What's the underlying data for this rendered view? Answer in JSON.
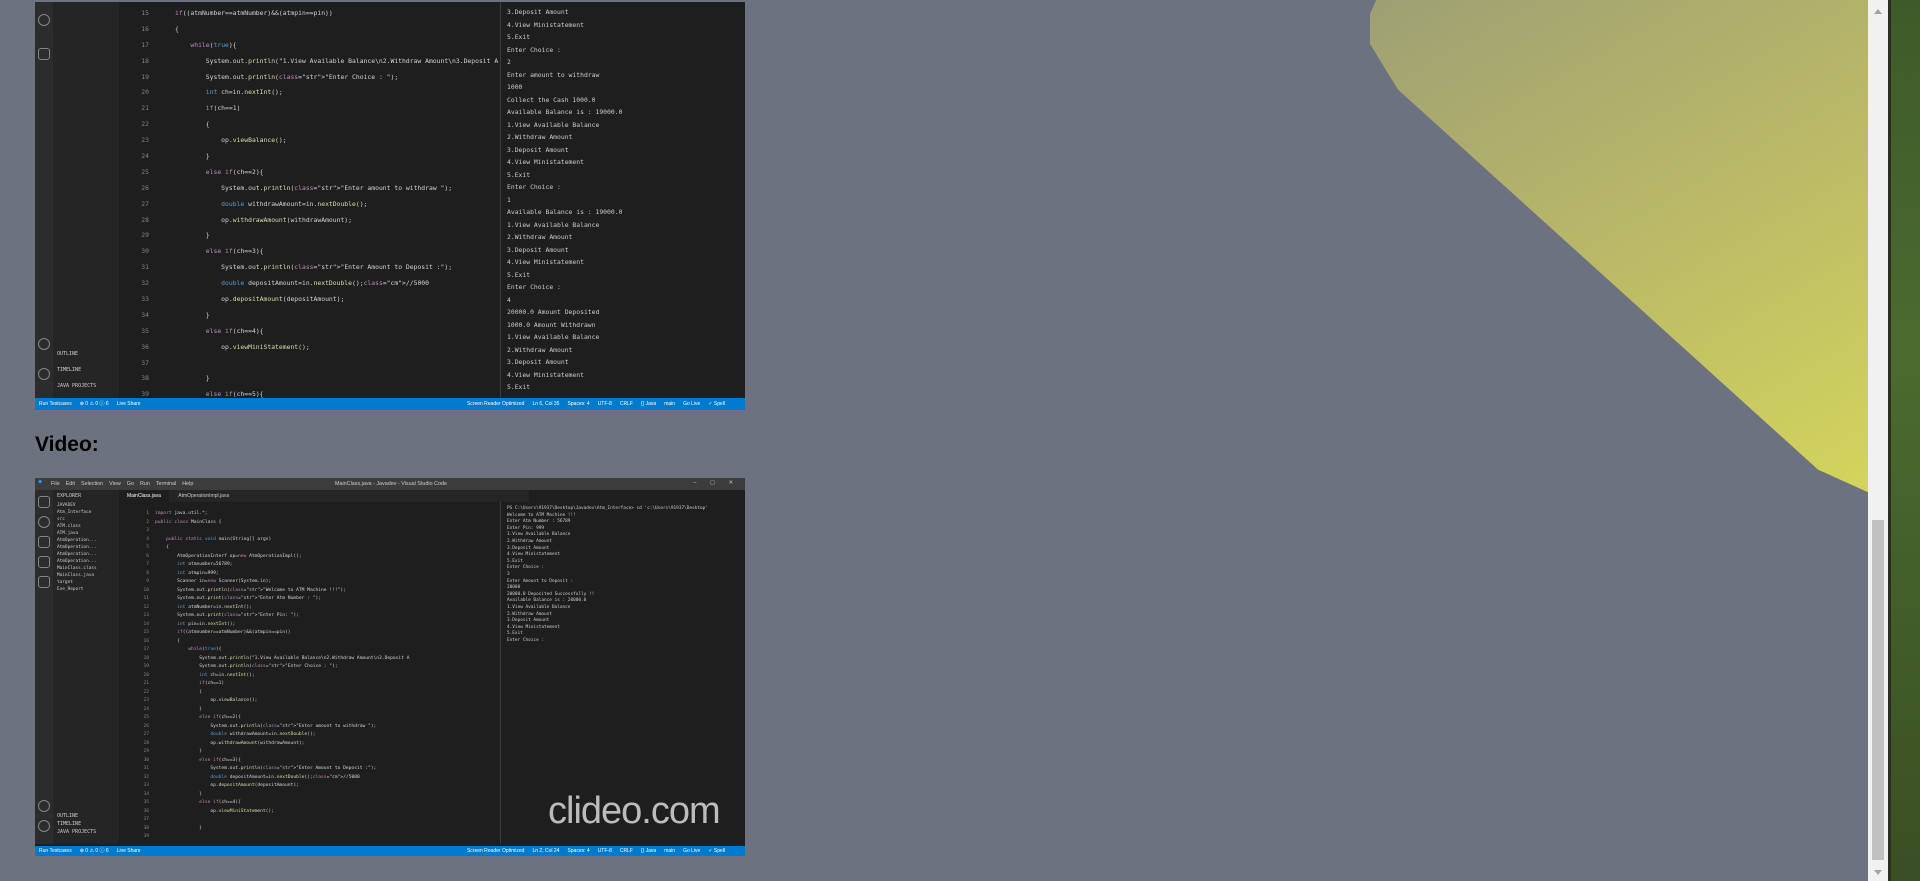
{
  "page": {
    "video_heading": "Video:"
  },
  "colors": {
    "background": "#6c7280",
    "statusbar": "#007acc",
    "editor_bg": "#1e1e1e",
    "accent_shape": "#d6d85a"
  },
  "top_screenshot": {
    "sidebar_sections": [
      "OUTLINE",
      "TIMELINE",
      "JAVA PROJECTS"
    ],
    "line_numbers": [
      "15",
      "16",
      "17",
      "18",
      "19",
      "20",
      "21",
      "22",
      "23",
      "24",
      "25",
      "26",
      "27",
      "28",
      "29",
      "30",
      "31",
      "32",
      "33",
      "34",
      "35",
      "36",
      "37",
      "38",
      "39"
    ],
    "code_lines": [
      "if((atmNumber==atmNumber)&&(atmpin==pin))",
      "{",
      "    while(true){",
      "        System.out.println(\"1.View Available Balance\\n2.Withdraw Amount\\n3.Deposit A",
      "        System.out.println(\"Enter Choice : \");",
      "        int ch=in.nextInt();",
      "        if(ch==1)",
      "        {",
      "            op.viewBalance();",
      "        }",
      "        else if(ch==2){",
      "            System.out.println(\"Enter amount to withdraw \");",
      "            double withdrawAmount=in.nextDouble();",
      "            op.withdrawAmount(withdrawAmount);",
      "        }",
      "        else if(ch==3){",
      "            System.out.println(\"Enter Amount to Deposit :\");",
      "            double depositAmount=in.nextDouble();//5000",
      "            op.depositAmount(depositAmount);",
      "        }",
      "        else if(ch==4){",
      "            op.viewMiniStatement();",
      "",
      "        }",
      "        else if(ch==5){"
    ],
    "terminal_lines": [
      "3.Deposit Amount",
      "4.View Ministatement",
      "5.Exit",
      "Enter Choice :",
      "2",
      "Enter amount to withdraw",
      "1000",
      "Collect the Cash 1000.0",
      "Available Balance is : 19000.0",
      "1.View Available Balance",
      "2.Withdraw Amount",
      "3.Deposit Amount",
      "4.View Ministatement",
      "5.Exit",
      "Enter Choice :",
      "1",
      "Available Balance is : 19000.0",
      "1.View Available Balance",
      "2.Withdraw Amount",
      "3.Deposit Amount",
      "4.View Ministatement",
      "5.Exit",
      "Enter Choice :",
      "4",
      "20000.0 Amount Deposited",
      "1000.0 Amount Withdrawn",
      "1.View Available Balance",
      "2.Withdraw Amount",
      "3.Deposit Amount",
      "4.View Ministatement",
      "5.Exit"
    ],
    "statusbar": {
      "left": [
        "Run Testcases",
        "⊗ 0 ⚠ 0 ⓘ 6",
        "Live Share"
      ],
      "right": [
        "Screen Reader Optimized",
        "Ln 6, Col 35",
        "Spaces: 4",
        "UTF-8",
        "CRLF",
        "{} Java",
        "main",
        "Go Live",
        "✓ Spell"
      ]
    }
  },
  "bottom_screenshot": {
    "window_title": "MainClass.java - Javadev - Visual Studio Code",
    "menu": [
      "File",
      "Edit",
      "Selection",
      "View",
      "Go",
      "Run",
      "Terminal",
      "Help"
    ],
    "tabs": [
      "MainClass.java",
      "AtmOperationImpl.java"
    ],
    "explorer_header": "EXPLORER",
    "tree": [
      "JAVADEV",
      "Atm_Interface",
      "src",
      "ATM.class",
      "ATM.java",
      "AtmOperation...",
      "AtmOperation...",
      "AtmOperation...",
      "AtmOperation...",
      "MainClass.class",
      "MainClass.java",
      "target",
      "Exe_Report"
    ],
    "sidebar_sections": [
      "OUTLINE",
      "TIMELINE",
      "JAVA PROJECTS"
    ],
    "line_numbers": [
      "1",
      "2",
      "3",
      "4",
      "5",
      "6",
      "7",
      "8",
      "9",
      "10",
      "11",
      "12",
      "13",
      "14",
      "15",
      "16",
      "17",
      "18",
      "19",
      "20",
      "21",
      "22",
      "23",
      "24",
      "25",
      "26",
      "27",
      "28",
      "29",
      "30",
      "31",
      "32",
      "33",
      "34",
      "35",
      "36",
      "37",
      "38",
      "39"
    ],
    "code_lines": [
      "import java.util.*;",
      "public class MainClass {",
      "",
      "    public static void main(String[] args)",
      "    {",
      "        AtmOperationInterf op=new AtmOperationImpl();",
      "        int atmnumber=56789;",
      "        int atmpin=999;",
      "        Scanner in=new Scanner(System.in);",
      "        System.out.println(\"Welcome to ATM Machine !!!\");",
      "        System.out.print(\"Enter Atm Number : \");",
      "        int atmNumber=in.nextInt();",
      "        System.out.print(\"Enter Pin: \");",
      "        int pin=in.nextInt();",
      "        if((atmnumber==atmNumber)&&(atmpin==pin))",
      "        {",
      "            while(true){",
      "                System.out.println(\"1.View Available Balance\\n2.Withdraw Amount\\n3.Deposit A",
      "                System.out.println(\"Enter Choice : \");",
      "                int ch=in.nextInt();",
      "                if(ch==1)",
      "                {",
      "                    op.viewBalance();",
      "                }",
      "                else if(ch==2){",
      "                    System.out.println(\"Enter amount to withdraw \");",
      "                    double withdrawAmount=in.nextDouble();",
      "                    op.withdrawAmount(withdrawAmount);",
      "                }",
      "                else if(ch==3){",
      "                    System.out.println(\"Enter Amount to Deposit :\");",
      "                    double depositAmount=in.nextDouble();//5000",
      "                    op.depositAmount(depositAmount);",
      "                }",
      "                else if(ch==4){",
      "                    op.viewMiniStatement();",
      "",
      "                }",
      ""
    ],
    "terminal_lines": [
      "PS C:\\Users\\91937\\Desktop\\Javadev\\Atm_Interface> cd 'c:\\Users\\91937\\Desktop'",
      "Welcome to ATM Machine !!!",
      "Enter Atm Number : 56789",
      "Enter Pin: 999",
      "1.View Available Balance",
      "2.Withdraw Amount",
      "3.Deposit Amount",
      "4.View Ministatement",
      "5.Exit",
      "Enter Choice :",
      "3",
      "Enter Amount to Deposit :",
      "20000",
      "20000.0 Deposited Successfully !!",
      "Available Balance is : 20000.0",
      "1.View Available Balance",
      "2.Withdraw Amount",
      "3.Deposit Amount",
      "4.View Ministatement",
      "5.Exit",
      "Enter Choice :"
    ],
    "statusbar": {
      "left": [
        "Run Testcases",
        "⊗ 0 ⚠ 0 ⓘ 6",
        "Live Share"
      ],
      "right": [
        "Screen Reader Optimized",
        "Ln 2, Col 24",
        "Spaces: 4",
        "UTF-8",
        "CRLF",
        "{} Java",
        "main",
        "Go Live",
        "✓ Spell"
      ]
    },
    "watermark": "clideo.com"
  }
}
